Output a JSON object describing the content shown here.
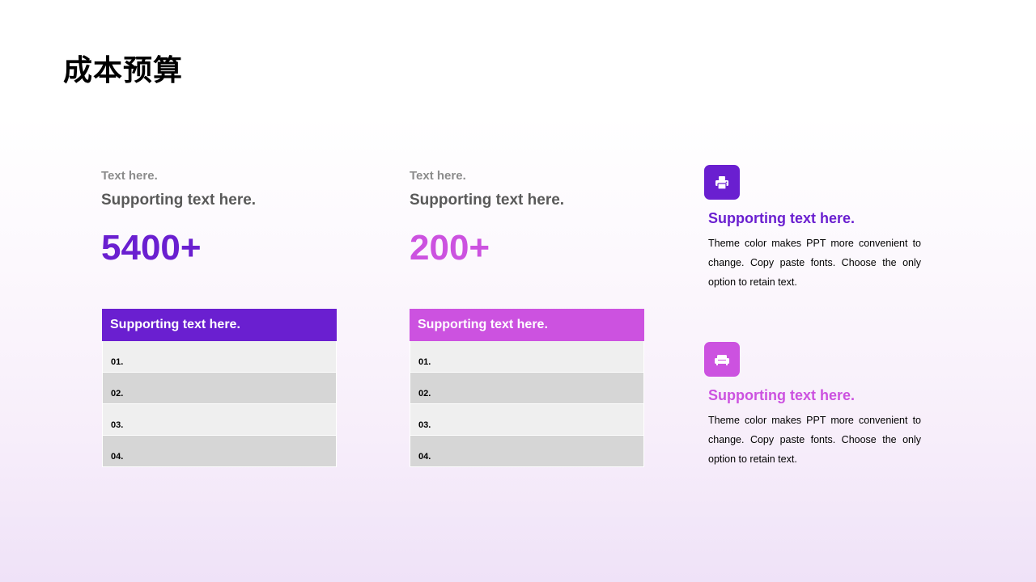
{
  "title": "成本预算",
  "colors": {
    "purple": "#6a1fd0",
    "magenta": "#cc52e0"
  },
  "columns": [
    {
      "small": "Text here.",
      "subtitle": "Supporting text here.",
      "value": "5400+",
      "table": {
        "header": "Supporting text here.",
        "rows": [
          "01.",
          "02.",
          "03.",
          "04."
        ]
      }
    },
    {
      "small": "Text here.",
      "subtitle": "Supporting text here.",
      "value": "200+",
      "table": {
        "header": "Supporting text here.",
        "rows": [
          "01.",
          "02.",
          "03.",
          "04."
        ]
      }
    }
  ],
  "features": [
    {
      "icon": "printer-icon",
      "title": "Supporting text here.",
      "body": "Theme color makes PPT more convenient to change. Copy paste fonts. Choose the only option to retain text."
    },
    {
      "icon": "sofa-icon",
      "title": "Supporting text here.",
      "body": "Theme color makes PPT more convenient to change. Copy paste fonts. Choose the only option to retain text."
    }
  ]
}
